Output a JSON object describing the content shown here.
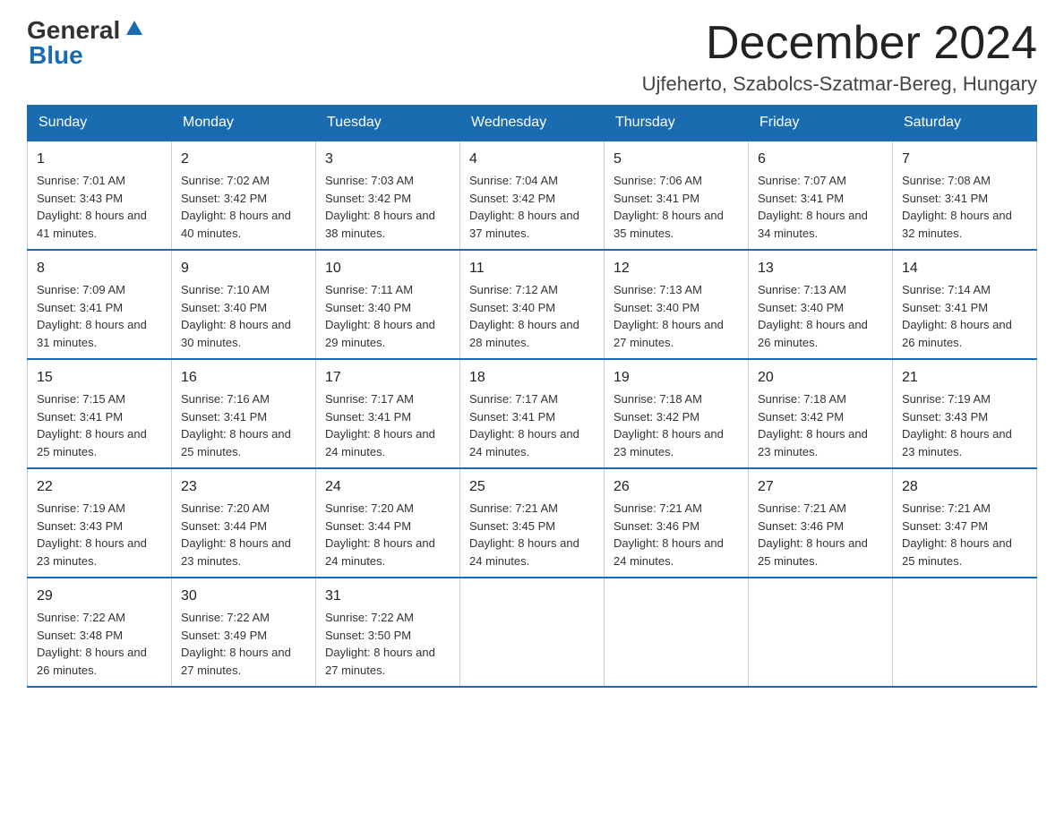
{
  "header": {
    "logo_general": "General",
    "logo_blue": "Blue",
    "month_title": "December 2024",
    "location": "Ujfeherto, Szabolcs-Szatmar-Bereg, Hungary"
  },
  "days_of_week": [
    "Sunday",
    "Monday",
    "Tuesday",
    "Wednesday",
    "Thursday",
    "Friday",
    "Saturday"
  ],
  "weeks": [
    [
      {
        "day": "1",
        "sunrise": "7:01 AM",
        "sunset": "3:43 PM",
        "daylight": "8 hours and 41 minutes."
      },
      {
        "day": "2",
        "sunrise": "7:02 AM",
        "sunset": "3:42 PM",
        "daylight": "8 hours and 40 minutes."
      },
      {
        "day": "3",
        "sunrise": "7:03 AM",
        "sunset": "3:42 PM",
        "daylight": "8 hours and 38 minutes."
      },
      {
        "day": "4",
        "sunrise": "7:04 AM",
        "sunset": "3:42 PM",
        "daylight": "8 hours and 37 minutes."
      },
      {
        "day": "5",
        "sunrise": "7:06 AM",
        "sunset": "3:41 PM",
        "daylight": "8 hours and 35 minutes."
      },
      {
        "day": "6",
        "sunrise": "7:07 AM",
        "sunset": "3:41 PM",
        "daylight": "8 hours and 34 minutes."
      },
      {
        "day": "7",
        "sunrise": "7:08 AM",
        "sunset": "3:41 PM",
        "daylight": "8 hours and 32 minutes."
      }
    ],
    [
      {
        "day": "8",
        "sunrise": "7:09 AM",
        "sunset": "3:41 PM",
        "daylight": "8 hours and 31 minutes."
      },
      {
        "day": "9",
        "sunrise": "7:10 AM",
        "sunset": "3:40 PM",
        "daylight": "8 hours and 30 minutes."
      },
      {
        "day": "10",
        "sunrise": "7:11 AM",
        "sunset": "3:40 PM",
        "daylight": "8 hours and 29 minutes."
      },
      {
        "day": "11",
        "sunrise": "7:12 AM",
        "sunset": "3:40 PM",
        "daylight": "8 hours and 28 minutes."
      },
      {
        "day": "12",
        "sunrise": "7:13 AM",
        "sunset": "3:40 PM",
        "daylight": "8 hours and 27 minutes."
      },
      {
        "day": "13",
        "sunrise": "7:13 AM",
        "sunset": "3:40 PM",
        "daylight": "8 hours and 26 minutes."
      },
      {
        "day": "14",
        "sunrise": "7:14 AM",
        "sunset": "3:41 PM",
        "daylight": "8 hours and 26 minutes."
      }
    ],
    [
      {
        "day": "15",
        "sunrise": "7:15 AM",
        "sunset": "3:41 PM",
        "daylight": "8 hours and 25 minutes."
      },
      {
        "day": "16",
        "sunrise": "7:16 AM",
        "sunset": "3:41 PM",
        "daylight": "8 hours and 25 minutes."
      },
      {
        "day": "17",
        "sunrise": "7:17 AM",
        "sunset": "3:41 PM",
        "daylight": "8 hours and 24 minutes."
      },
      {
        "day": "18",
        "sunrise": "7:17 AM",
        "sunset": "3:41 PM",
        "daylight": "8 hours and 24 minutes."
      },
      {
        "day": "19",
        "sunrise": "7:18 AM",
        "sunset": "3:42 PM",
        "daylight": "8 hours and 23 minutes."
      },
      {
        "day": "20",
        "sunrise": "7:18 AM",
        "sunset": "3:42 PM",
        "daylight": "8 hours and 23 minutes."
      },
      {
        "day": "21",
        "sunrise": "7:19 AM",
        "sunset": "3:43 PM",
        "daylight": "8 hours and 23 minutes."
      }
    ],
    [
      {
        "day": "22",
        "sunrise": "7:19 AM",
        "sunset": "3:43 PM",
        "daylight": "8 hours and 23 minutes."
      },
      {
        "day": "23",
        "sunrise": "7:20 AM",
        "sunset": "3:44 PM",
        "daylight": "8 hours and 23 minutes."
      },
      {
        "day": "24",
        "sunrise": "7:20 AM",
        "sunset": "3:44 PM",
        "daylight": "8 hours and 24 minutes."
      },
      {
        "day": "25",
        "sunrise": "7:21 AM",
        "sunset": "3:45 PM",
        "daylight": "8 hours and 24 minutes."
      },
      {
        "day": "26",
        "sunrise": "7:21 AM",
        "sunset": "3:46 PM",
        "daylight": "8 hours and 24 minutes."
      },
      {
        "day": "27",
        "sunrise": "7:21 AM",
        "sunset": "3:46 PM",
        "daylight": "8 hours and 25 minutes."
      },
      {
        "day": "28",
        "sunrise": "7:21 AM",
        "sunset": "3:47 PM",
        "daylight": "8 hours and 25 minutes."
      }
    ],
    [
      {
        "day": "29",
        "sunrise": "7:22 AM",
        "sunset": "3:48 PM",
        "daylight": "8 hours and 26 minutes."
      },
      {
        "day": "30",
        "sunrise": "7:22 AM",
        "sunset": "3:49 PM",
        "daylight": "8 hours and 27 minutes."
      },
      {
        "day": "31",
        "sunrise": "7:22 AM",
        "sunset": "3:50 PM",
        "daylight": "8 hours and 27 minutes."
      },
      null,
      null,
      null,
      null
    ]
  ],
  "labels": {
    "sunrise_prefix": "Sunrise: ",
    "sunset_prefix": "Sunset: ",
    "daylight_prefix": "Daylight: "
  }
}
